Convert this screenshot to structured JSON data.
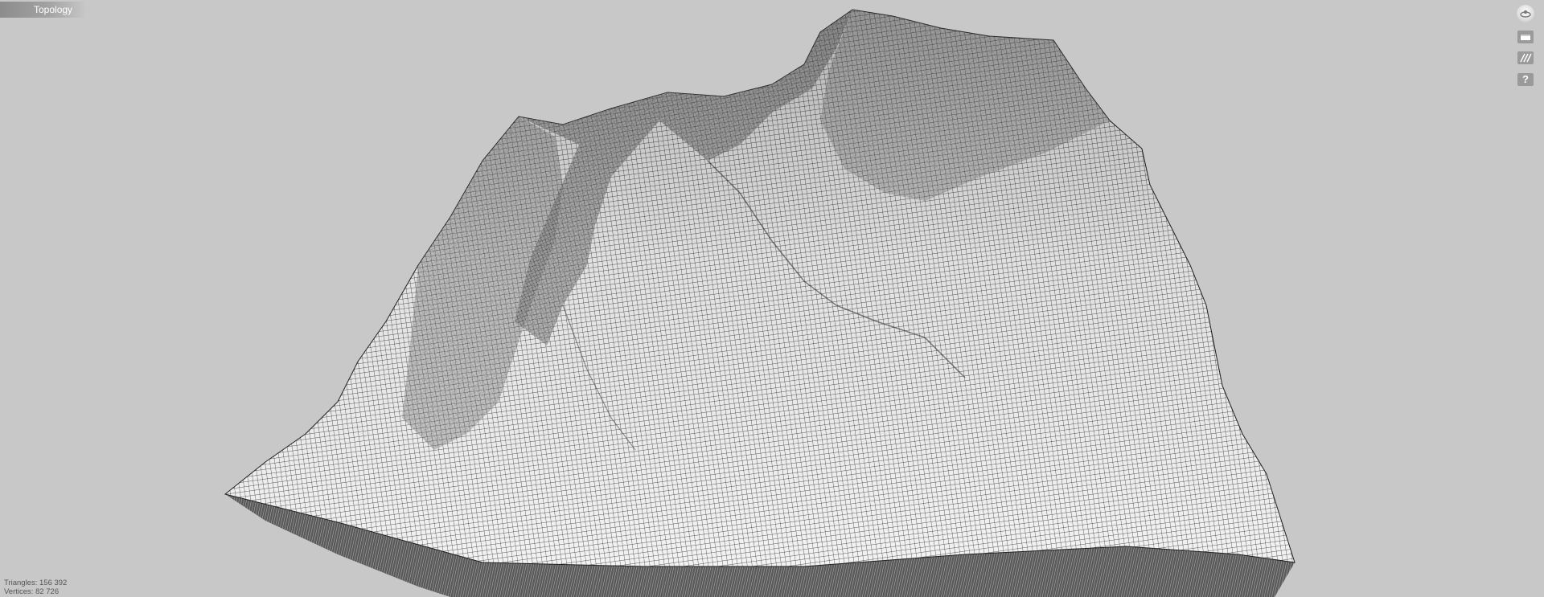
{
  "title_tab": {
    "label": "Topology"
  },
  "toolbar": {
    "buttons": [
      {
        "name": "view-orbit-icon"
      },
      {
        "name": "panel-icon"
      },
      {
        "name": "texture-stripes-icon"
      },
      {
        "name": "help-icon",
        "glyph": "?"
      }
    ]
  },
  "stats": {
    "triangles": "Triangles: 156 392",
    "vertices": "Vertices: 82 726"
  },
  "colors": {
    "background": "#c8c8c8",
    "mesh_fill": "#f4f4f4",
    "mesh_lines": "#2a2a2a",
    "mesh_side": "#4a4a4a"
  }
}
